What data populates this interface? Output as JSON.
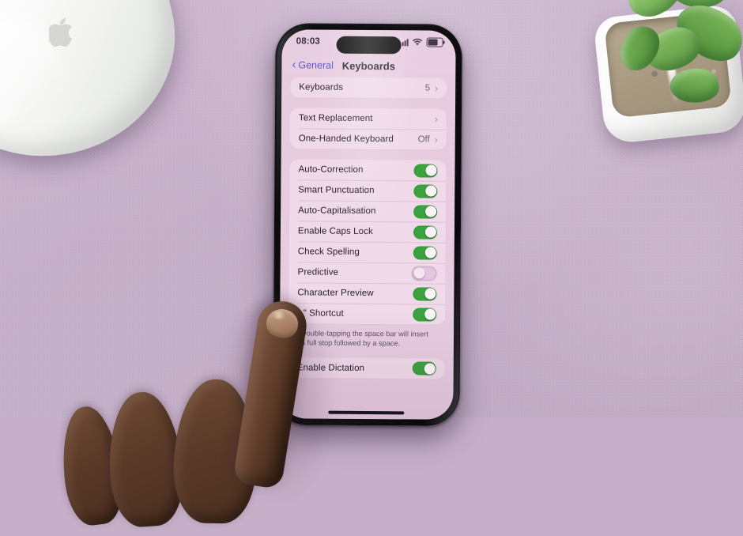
{
  "scene": {
    "description": "Hand holding an iPhone showing iOS Keyboards settings on a lavender desk",
    "objects": {
      "mouse_label": "apple-magic-mouse",
      "plant_label": "succulent-in-white-pot",
      "hand_label": "hand-holding-phone"
    },
    "colors": {
      "desk": "#c6b0c9",
      "screen_background": "#e7cce0",
      "card_background": "#f0d9e9",
      "toggle_on": "#3aa23f",
      "toggle_off": "#e4c6de",
      "accent_blue": "#5a53c8",
      "text_primary": "#241d28",
      "text_secondary": "#6e6274"
    }
  },
  "phone": {
    "status_bar": {
      "time": "08:03",
      "signal_icon": "cellular-signal-icon",
      "wifi_icon": "wifi-icon",
      "battery_icon": "battery-icon",
      "battery_level_percent": 62
    },
    "nav_bar": {
      "back_label": "General",
      "back_icon": "chevron-left-icon",
      "title": "Keyboards"
    },
    "groups": [
      {
        "id": "keyboards-group",
        "rows": [
          {
            "label": "Keyboards",
            "type": "disclosure",
            "value": "5",
            "accessory_icon": "chevron-right-icon"
          }
        ]
      },
      {
        "id": "text-group",
        "rows": [
          {
            "label": "Text Replacement",
            "type": "disclosure",
            "value": "",
            "accessory_icon": "chevron-right-icon"
          },
          {
            "label": "One-Handed Keyboard",
            "type": "disclosure",
            "value": "Off",
            "accessory_icon": "chevron-right-icon"
          }
        ]
      },
      {
        "id": "all-keyboards-group",
        "rows": [
          {
            "label": "Auto-Correction",
            "type": "toggle",
            "state": "on"
          },
          {
            "label": "Smart Punctuation",
            "type": "toggle",
            "state": "on"
          },
          {
            "label": "Auto-Capitalisation",
            "type": "toggle",
            "state": "on"
          },
          {
            "label": "Enable Caps Lock",
            "type": "toggle",
            "state": "on"
          },
          {
            "label": "Check Spelling",
            "type": "toggle",
            "state": "on"
          },
          {
            "label": "Predictive",
            "type": "toggle",
            "state": "off"
          },
          {
            "label": "Character Preview",
            "type": "toggle",
            "state": "on"
          },
          {
            "label": "\".\" Shortcut",
            "type": "toggle",
            "state": "on"
          }
        ],
        "footnote": "Double-tapping the space bar will insert a full stop followed by a space."
      },
      {
        "id": "dictation-group",
        "rows": [
          {
            "label": "Enable Dictation",
            "type": "toggle",
            "state": "on"
          }
        ]
      }
    ],
    "home_indicator": "home-indicator"
  }
}
